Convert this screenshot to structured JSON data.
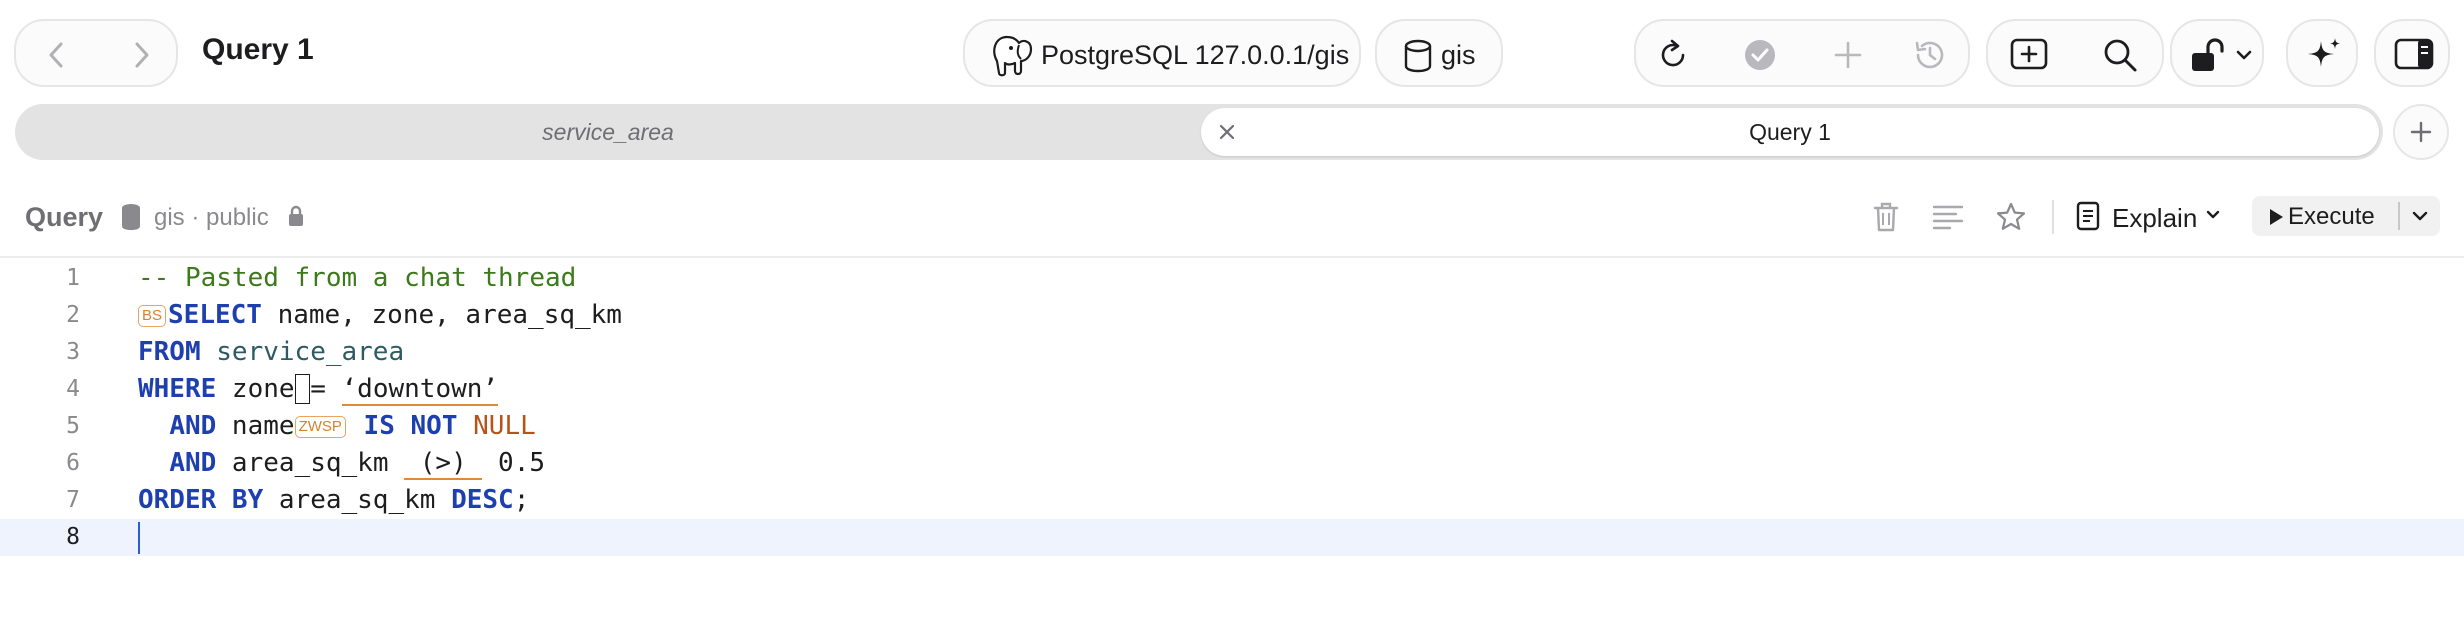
{
  "window": {
    "title": "Query 1",
    "connection_label": "PostgreSQL 127.0.0.1/gis",
    "database_label": "gis"
  },
  "tabs": [
    {
      "label": "service_area",
      "active": false
    },
    {
      "label": "Query 1",
      "active": true
    }
  ],
  "query_header": {
    "label": "Query",
    "breadcrumb": "gis · public",
    "explain_label": "Explain",
    "execute_label": "Execute"
  },
  "editor": {
    "lines": [
      {
        "num": "1",
        "comment": "-- Pasted from a chat thread"
      },
      {
        "num": "2",
        "badge": "BS",
        "kw": "SELECT",
        "rest": " name, zone, area_sq_km"
      },
      {
        "num": "3",
        "kw": "FROM",
        "table": " service_area"
      },
      {
        "num": "4",
        "kw": "WHERE",
        "pre": " zone",
        "gap": " ",
        "mid": "= ",
        "str": "‘downtown’"
      },
      {
        "num": "5",
        "kw1": "AND",
        "pre": " name",
        "badge": "ZWSP",
        "kw2": " IS NOT",
        "nl": " NULL"
      },
      {
        "num": "6",
        "kw1": "AND",
        "pre": " area_sq_km ",
        "op": " (>) ",
        "post": " 0.5"
      },
      {
        "num": "7",
        "kw1": "ORDER BY",
        "pre": " area_sq_km ",
        "kw2": "DESC",
        "post": ";"
      },
      {
        "num": "8"
      }
    ]
  },
  "colors": {
    "keyword": "#1e3fae",
    "comment": "#3c7a1b",
    "warning": "#d9822b",
    "active_line": "#eef3fd",
    "caret": "#2d5bd6"
  }
}
